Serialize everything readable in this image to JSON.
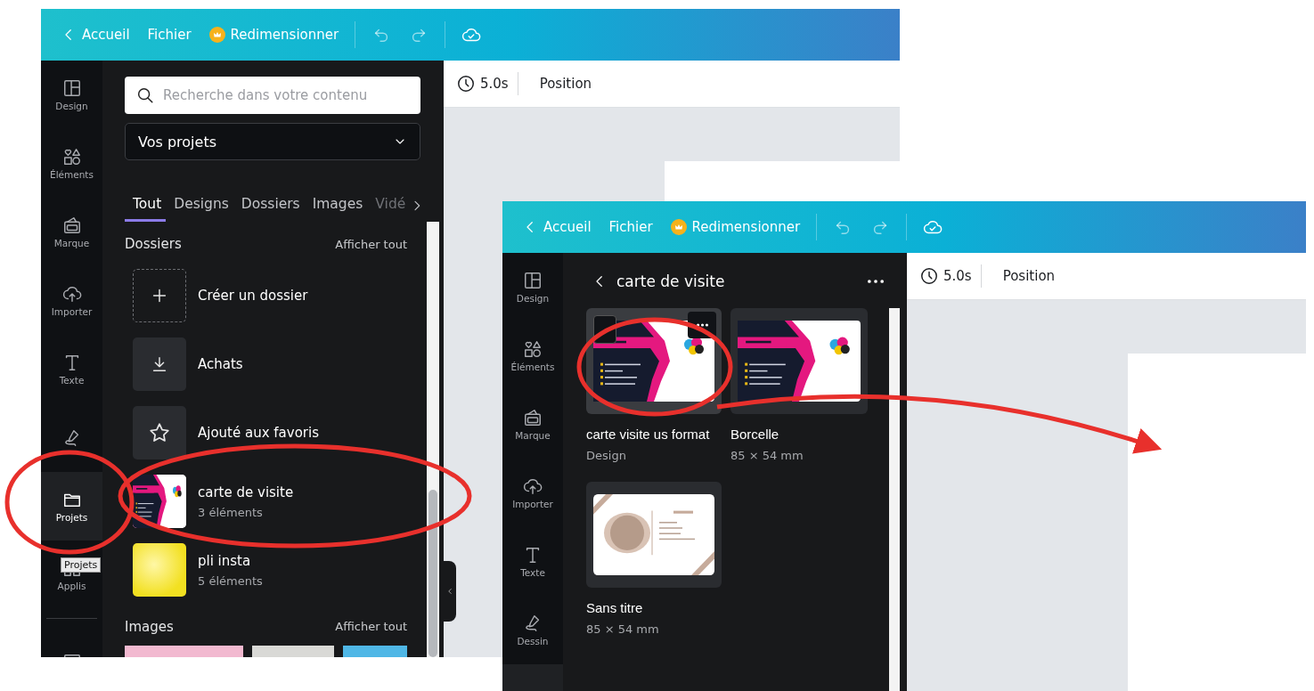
{
  "main_window": {
    "top_bar": {
      "back": "Accueil",
      "file": "Fichier",
      "resize": "Redimensionner"
    },
    "toolbar": {
      "duration": "5.0s",
      "position": "Position"
    },
    "rail": [
      {
        "kind": "layout",
        "label": "Design",
        "selected": false
      },
      {
        "kind": "shapes",
        "label": "Éléments",
        "selected": false
      },
      {
        "kind": "brand",
        "label": "Marque",
        "selected": false
      },
      {
        "kind": "upload",
        "label": "Importer",
        "selected": false
      },
      {
        "kind": "text",
        "label": "Texte",
        "selected": false
      },
      {
        "kind": "draw",
        "selected": false
      },
      {
        "kind": "folder",
        "label": "Projets",
        "selected": true
      },
      {
        "kind": "apps",
        "label": "Applis",
        "selected": false
      },
      {
        "kind": "image",
        "selected": false
      }
    ],
    "tooltip": "Projets",
    "search": {
      "placeholder": "Recherche dans votre contenu"
    },
    "dropdown": {
      "value": "Vos projets"
    },
    "tabs": [
      {
        "label": "Tout",
        "selected": true
      },
      {
        "label": "Designs",
        "selected": false
      },
      {
        "label": "Dossiers",
        "selected": false
      },
      {
        "label": "Images",
        "selected": false
      },
      {
        "label": "Vidé",
        "selected": false
      }
    ],
    "sections": [
      {
        "kind": "folders",
        "title": "Dossiers",
        "link": "Afficher tout",
        "items": [
          {
            "kind": "create",
            "name": "Créer un dossier"
          },
          {
            "kind": "purchases",
            "name": "Achats"
          },
          {
            "kind": "favorites",
            "name": "Ajouté aux favoris"
          },
          {
            "kind": "business-card",
            "name": "carte de visite",
            "count": "3 éléments"
          },
          {
            "kind": "yellow",
            "name": "pli insta",
            "count": "5 éléments"
          }
        ]
      },
      {
        "kind": "images",
        "title": "Images",
        "link": "Afficher tout"
      }
    ]
  },
  "folder_window": {
    "top_bar": {
      "back": "Accueil",
      "file": "Fichier",
      "resize": "Redimensionner"
    },
    "toolbar": {
      "duration": "5.0s",
      "position": "Position"
    },
    "rail": [
      {
        "kind": "layout",
        "label": "Design",
        "selected": false
      },
      {
        "kind": "shapes",
        "label": "Éléments",
        "selected": false
      },
      {
        "kind": "brand",
        "label": "Marque",
        "selected": false
      },
      {
        "kind": "upload",
        "label": "Importer",
        "selected": false
      },
      {
        "kind": "text",
        "label": "Texte",
        "selected": false
      },
      {
        "kind": "draw",
        "label": "Dessin",
        "selected": false
      },
      {
        "kind": "folder",
        "selected": true
      }
    ],
    "title": "carte de visite",
    "designs": [
      {
        "kind": "business-card",
        "title": "carte visite us format",
        "subtitle": "Design",
        "hovered": true
      },
      {
        "kind": "business-card",
        "title": "Borcelle",
        "subtitle": "85 × 54 mm",
        "hovered": false
      },
      {
        "kind": "portrait-card",
        "title": "Sans titre",
        "subtitle": "85 × 54 mm",
        "hovered": false
      }
    ]
  }
}
